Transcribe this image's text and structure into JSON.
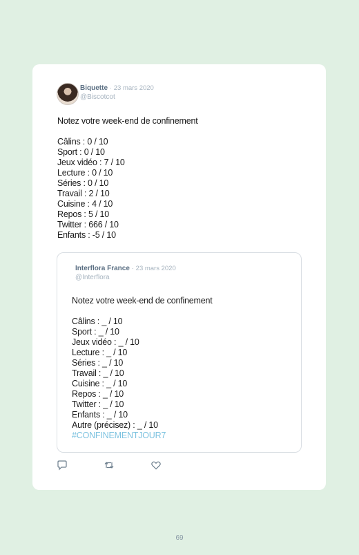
{
  "tweet": {
    "author_name": "Biquette",
    "separator": "·",
    "date": "23 mars 2020",
    "handle": "@Biscotcot",
    "lines": [
      "Notez votre week-end de confinement",
      "",
      "Câlins : 0 / 10",
      "Sport : 0 / 10",
      "Jeux vidéo : 7 / 10",
      "Lecture : 0 / 10",
      "Séries : 0 / 10",
      "Travail : 2 / 10",
      "Cuisine : 4 / 10",
      "Repos : 5 / 10",
      "Twitter : 666 / 10",
      "Enfants : -5 / 10"
    ]
  },
  "quoted": {
    "author_name": "Interflora France",
    "separator": "·",
    "date": "23 mars 2020",
    "handle": "@Interflora",
    "lines": [
      "Notez votre week-end de confinement",
      "",
      "Câlins : _ / 10",
      "Sport : _ / 10",
      "Jeux vidéo : _ / 10",
      "Lecture : _ / 10",
      "Séries : _ / 10",
      "Travail : _ / 10",
      "Cuisine : _ / 10",
      "Repos : _ / 10",
      "Twitter : _ / 10",
      "Enfants : _ / 10",
      "Autre (précisez) : _ / 10"
    ],
    "hashtag": "#CONFINEMENTJOUR7"
  },
  "actions": [
    {
      "name": "reply",
      "icon": "reply-icon"
    },
    {
      "name": "retweet",
      "icon": "retweet-icon"
    },
    {
      "name": "like",
      "icon": "heart-icon"
    }
  ],
  "page_number": "69",
  "colors": {
    "background": "#e0f0e3",
    "card": "#ffffff",
    "hashtag": "#7ec3e0",
    "author": "#5b6f83",
    "meta": "#a6b3bf"
  }
}
